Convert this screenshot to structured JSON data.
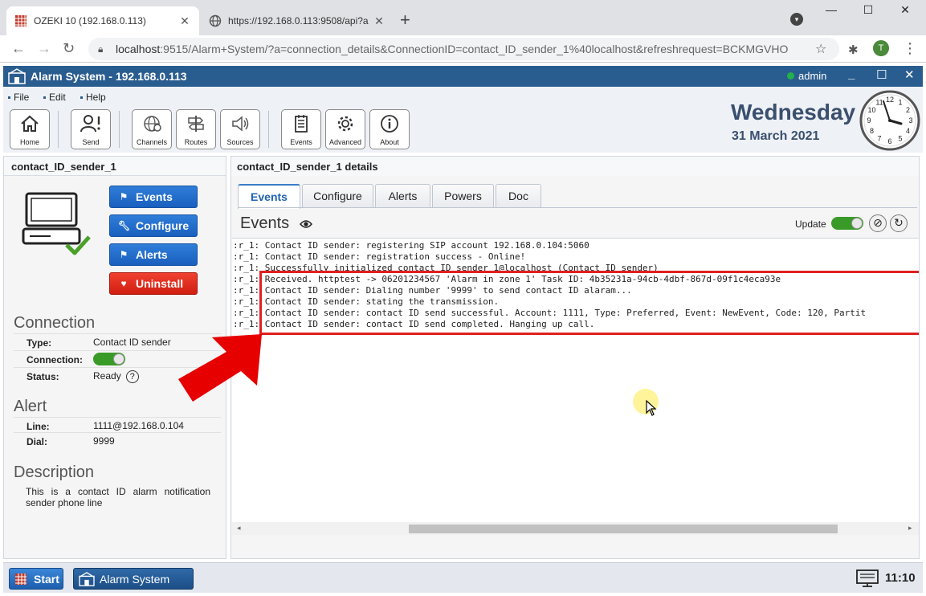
{
  "browser": {
    "tabs": [
      {
        "title": "OZEKI 10 (192.168.0.113)",
        "active": true
      },
      {
        "title": "https://192.168.0.113:9508/api?a",
        "active": false
      }
    ],
    "url_host": "localhost",
    "url_rest": ":9515/Alarm+System/?a=connection_details&ConnectionID=contact_ID_sender_1%40localhost&refreshrequest=BCKMGVHO",
    "profile_initial": "T"
  },
  "app": {
    "title": "Alarm System - 192.168.0.113",
    "user": "admin",
    "menu": [
      "File",
      "Edit",
      "Help"
    ],
    "toolbar": [
      {
        "label": "Home",
        "icon": "home-icon"
      },
      {
        "label": "Send",
        "icon": "send-icon"
      },
      {
        "label": "Channels",
        "icon": "channels-icon"
      },
      {
        "label": "Routes",
        "icon": "routes-icon"
      },
      {
        "label": "Sources",
        "icon": "sources-icon"
      },
      {
        "label": "Events",
        "icon": "events-icon"
      },
      {
        "label": "Advanced",
        "icon": "gear-icon"
      },
      {
        "label": "About",
        "icon": "info-icon"
      }
    ],
    "day": "Wednesday",
    "date": "31 March 2021",
    "clock_numbers": [
      "12",
      "1",
      "2",
      "3",
      "4",
      "5",
      "6",
      "7",
      "8",
      "9",
      "10",
      "11"
    ]
  },
  "left": {
    "header": "contact_ID_sender_1",
    "buttons": {
      "events": "Events",
      "configure": "Configure",
      "alerts": "Alerts",
      "uninstall": "Uninstall"
    },
    "connection": {
      "title": "Connection",
      "type_label": "Type:",
      "type_value": "Contact ID sender",
      "conn_label": "Connection:",
      "conn_on": true,
      "status_label": "Status:",
      "status_value": "Ready",
      "help": "?"
    },
    "alert": {
      "title": "Alert",
      "line_label": "Line:",
      "line_value": "1111@192.168.0.104",
      "dial_label": "Dial:",
      "dial_value": "9999"
    },
    "description": {
      "title": "Description",
      "text": "This is a contact ID alarm notification sender phone line"
    }
  },
  "right": {
    "header": "contact_ID_sender_1 details",
    "tabs": [
      "Events",
      "Configure",
      "Alerts",
      "Powers",
      "Doc"
    ],
    "events_title": "Events",
    "update_label": "Update",
    "log": [
      ":r_1: Contact ID sender: registering SIP account 192.168.0.104:5060",
      ":r_1: Contact ID sender: registration success - Online!",
      ":r_1: Successfully initialized contact_ID_sender_1@localhost (Contact ID sender)",
      ":r_1: Received. httptest -> 06201234567 'Alarm in zone 1' Task ID: 4b35231a-94cb-4dbf-867d-09f1c4eca93e",
      ":r_1: Contact ID sender: Dialing number '9999' to send contact ID alaram...",
      ":r_1: Contact ID sender: stating the transmission.",
      ":r_1: Contact ID sender: contact ID send successful. Account: 1111, Type: Preferred, Event: NewEvent, Code: 120, Partit",
      ":r_1: Contact ID sender: contact ID send completed. Hanging up call."
    ]
  },
  "taskbar": {
    "start": "Start",
    "app": "Alarm System",
    "time": "11:10"
  },
  "colors": {
    "title_bar": "#2a5d8f",
    "button_blue": "#1a5fbf",
    "button_red": "#d01e10",
    "highlight": "#e02020",
    "toggle_on": "#3a9a28"
  }
}
